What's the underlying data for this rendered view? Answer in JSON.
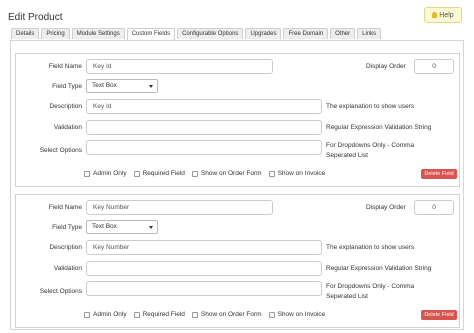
{
  "page": {
    "title": "Edit Product",
    "help_label": "Help"
  },
  "tabs": [
    {
      "label": "Details"
    },
    {
      "label": "Pricing"
    },
    {
      "label": "Module Settings"
    },
    {
      "label": "Custom Fields"
    },
    {
      "label": "Configurable Options"
    },
    {
      "label": "Upgrades"
    },
    {
      "label": "Free Domain"
    },
    {
      "label": "Other"
    },
    {
      "label": "Links"
    }
  ],
  "labels": {
    "field_name": "Field Name",
    "field_type": "Field Type",
    "description": "Description",
    "validation": "Validation",
    "select_options": "Select Options",
    "display_order": "Display Order",
    "desc_hint": "The explanation to show users",
    "validation_hint": "Regular Expression Validation String",
    "select_hint": "For Dropdowns Only - Comma Seperated List",
    "admin_only": "Admin Only",
    "required_field": "Required Field",
    "show_order_form": "Show on Order Form",
    "show_invoice": "Show on Invoice",
    "delete_field": "Delete Field"
  },
  "fields": [
    {
      "field_name": "Key Id",
      "field_type": "Text Box",
      "description": "Key Id",
      "validation": "",
      "select_options": "",
      "display_order": "0"
    },
    {
      "field_name": "Key Number",
      "field_type": "Text Box",
      "description": "Key Number",
      "validation": "",
      "select_options": "",
      "display_order": "0"
    }
  ],
  "colors": {
    "delete": "#d9534f",
    "help_bg": "#fcf8d4"
  }
}
